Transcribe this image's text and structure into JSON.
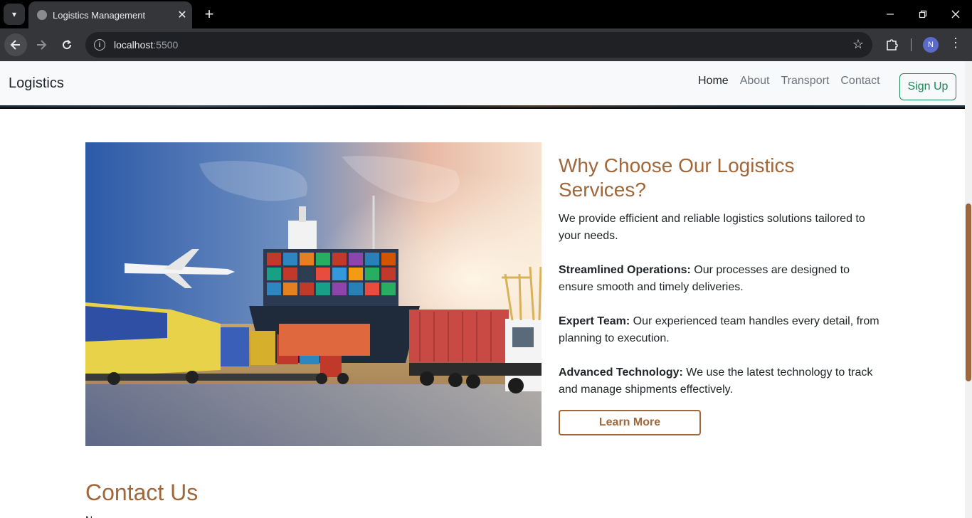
{
  "browser": {
    "tab_title": "Logistics Management",
    "tab_close": "✕",
    "new_tab": "+",
    "url_host": "localhost",
    "url_port": ":5500",
    "avatar_initial": "N",
    "icons": [
      "tab-list-icon",
      "favicon-icon",
      "close-icon",
      "plus-icon",
      "minimize-icon",
      "restore-icon",
      "window-close-icon",
      "back-icon",
      "forward-icon",
      "reload-icon",
      "info-icon",
      "star-icon",
      "extensions-icon",
      "kebab-icon"
    ]
  },
  "navbar": {
    "brand": "Logistics",
    "links": [
      "Home",
      "About",
      "Transport",
      "Contact"
    ],
    "active": "Home",
    "signup_label": "Sign Up"
  },
  "feature": {
    "heading": "Why Choose Our Logistics Services?",
    "intro": "We provide efficient and reliable logistics solutions tailored to your needs.",
    "points": [
      {
        "title": "Streamlined Operations:",
        "text": " Our processes are designed to ensure smooth and timely deliveries."
      },
      {
        "title": "Expert Team:",
        "text": " Our experienced team handles every detail, from planning to execution."
      },
      {
        "title": "Advanced Technology:",
        "text": " We use the latest technology to track and manage shipments effectively."
      }
    ],
    "button_label": "Learn More"
  },
  "contact": {
    "title": "Contact Us",
    "first_label": "N"
  },
  "colors": {
    "accent": "#a0673a",
    "signup": "#198754",
    "navbar_bg": "#f8f9fa",
    "chrome_dark": "#35363a"
  }
}
